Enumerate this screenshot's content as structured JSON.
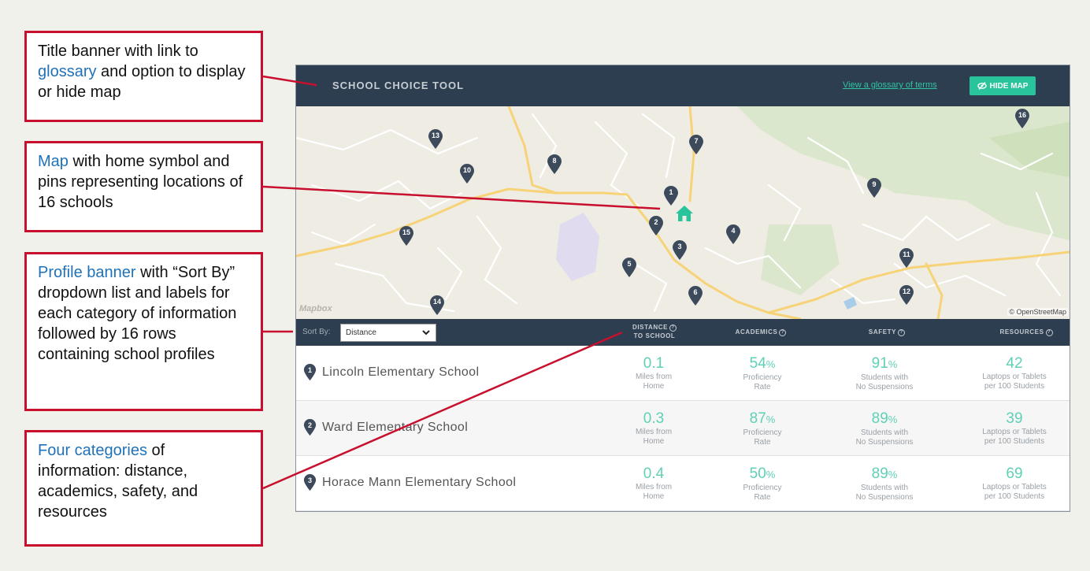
{
  "callouts": [
    {
      "pre": "Title banner with link to ",
      "hl": "glossary",
      "post": " and option to display or hide map"
    },
    {
      "pre": "",
      "hl": "Map",
      "post": " with home symbol and pins representing locations of 16 schools"
    },
    {
      "pre": "",
      "hl": "Profile banner",
      "post": " with “Sort By” dropdown list and labels for each category of information followed by 16 rows containing school profiles"
    },
    {
      "pre": "",
      "hl": "Four categories",
      "post": " of information: distance, academics, safety, and resources"
    }
  ],
  "header": {
    "title": "SCHOOL CHOICE TOOL",
    "glossary_link": "View a glossary of terms",
    "hide_map_label": "HIDE MAP"
  },
  "map": {
    "pins": [
      "1",
      "2",
      "3",
      "4",
      "5",
      "6",
      "7",
      "8",
      "9",
      "10",
      "11",
      "12",
      "13",
      "14",
      "15",
      "16"
    ],
    "attribution_logo": "Mapbox",
    "attribution": "© OpenStreetMap"
  },
  "profile_banner": {
    "sort_label": "Sort By:",
    "sort_value": "Distance",
    "columns": {
      "distance": "DISTANCE",
      "distance_2": "TO SCHOOL",
      "academics": "ACADEMICS",
      "safety": "SAFETY",
      "resources": "RESOURCES"
    }
  },
  "schools": [
    {
      "rank": "1",
      "name": "Lincoln Elementary School",
      "distance": "0.1",
      "distance_l1": "Miles from",
      "distance_l2": "Home",
      "academics": "54",
      "academics_l1": "Proficiency",
      "academics_l2": "Rate",
      "safety": "91",
      "safety_l1": "Students with",
      "safety_l2": "No Suspensions",
      "resources": "42",
      "resources_l1": "Laptops or Tablets",
      "resources_l2": "per 100 Students"
    },
    {
      "rank": "2",
      "name": "Ward Elementary School",
      "distance": "0.3",
      "distance_l1": "Miles from",
      "distance_l2": "Home",
      "academics": "87",
      "academics_l1": "Proficiency",
      "academics_l2": "Rate",
      "safety": "89",
      "safety_l1": "Students with",
      "safety_l2": "No Suspensions",
      "resources": "39",
      "resources_l1": "Laptops or Tablets",
      "resources_l2": "per 100 Students"
    },
    {
      "rank": "3",
      "name": "Horace Mann Elementary School",
      "distance": "0.4",
      "distance_l1": "Miles from",
      "distance_l2": "Home",
      "academics": "50",
      "academics_l1": "Proficiency",
      "academics_l2": "Rate",
      "safety": "89",
      "safety_l1": "Students with",
      "safety_l2": "No Suspensions",
      "resources": "69",
      "resources_l1": "Laptops or Tablets",
      "resources_l2": "per 100 Students"
    }
  ],
  "percent_sign": "%",
  "colors": {
    "banner": "#2d3e50",
    "accent": "#29c49b",
    "callout_border": "#c8102e",
    "callout_highlight": "#1f72b8",
    "pin": "#3c4a5c"
  },
  "icons": {
    "home": "home-icon",
    "hide": "eye-slash-icon",
    "pin": "map-pin-icon",
    "dropdown": "chevron-down-icon",
    "help": "question-circle-icon"
  }
}
